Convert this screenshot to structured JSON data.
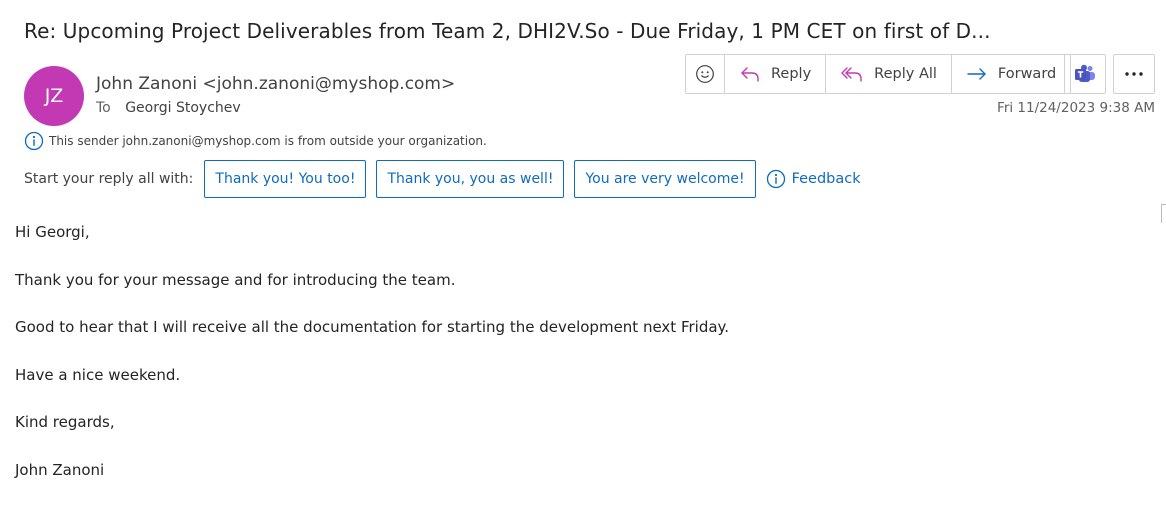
{
  "email": {
    "subject": "Re: Upcoming Project Deliverables from Team 2, DHI2V.So - Due Friday, 1 PM CET on first of D...",
    "avatar_initials": "JZ",
    "avatar_color": "#c239b3",
    "sender": "John Zanoni <john.zanoni@myshop.com>",
    "to_label": "To",
    "recipient": "Georgi Stoychev",
    "timestamp": "Fri 11/24/2023 9:38 AM",
    "external_notice": "This sender john.zanoni@myshop.com is from outside your organization."
  },
  "actions": {
    "emoji_icon": "emoji-smile-icon",
    "reply_label": "Reply",
    "reply_all_label": "Reply All",
    "forward_label": "Forward",
    "teams_icon": "teams-icon",
    "more_icon": "more-options-icon"
  },
  "suggested_replies": {
    "label": "Start your reply all with:",
    "options": [
      "Thank you! You too!",
      "Thank you, you as well!",
      "You are very welcome!"
    ],
    "feedback_label": "Feedback"
  },
  "body": {
    "paragraphs": [
      "Hi Georgi,",
      "Thank you for your message and for introducing the team.",
      "Good to hear that I will receive all the documentation for starting the development next Friday.",
      "Have a nice weekend.",
      "Kind regards,",
      "John Zanoni"
    ]
  },
  "colors": {
    "accent": "#0f6cbd",
    "reply_icon": "#c239b3",
    "forward_icon": "#0f6cbd",
    "teams": "#5059c9"
  }
}
